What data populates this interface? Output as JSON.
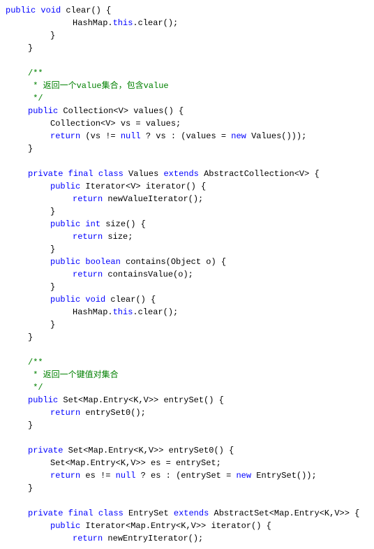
{
  "lines": [
    {
      "indent": 0,
      "tokens": [
        {
          "t": "kw",
          "s": "public"
        },
        {
          "t": "sp"
        },
        {
          "t": "kw",
          "s": "void"
        },
        {
          "t": "pl",
          "s": " clear() {"
        }
      ]
    },
    {
      "indent": 3,
      "tokens": [
        {
          "t": "pl",
          "s": "HashMap."
        },
        {
          "t": "kw",
          "s": "this"
        },
        {
          "t": "pl",
          "s": ".clear();"
        }
      ]
    },
    {
      "indent": 2,
      "tokens": [
        {
          "t": "pl",
          "s": "}"
        }
      ]
    },
    {
      "indent": 1,
      "tokens": [
        {
          "t": "pl",
          "s": "}"
        }
      ]
    },
    {
      "indent": 0,
      "tokens": []
    },
    {
      "indent": 1,
      "tokens": [
        {
          "t": "cm",
          "s": "/**"
        }
      ]
    },
    {
      "indent": 1,
      "tokens": [
        {
          "t": "cm",
          "s": " * 返回一个value集合，包含value"
        }
      ]
    },
    {
      "indent": 1,
      "tokens": [
        {
          "t": "cm",
          "s": " */"
        }
      ]
    },
    {
      "indent": 1,
      "tokens": [
        {
          "t": "kw",
          "s": "public"
        },
        {
          "t": "pl",
          "s": " Collection<V> values() {"
        }
      ]
    },
    {
      "indent": 2,
      "tokens": [
        {
          "t": "pl",
          "s": "Collection<V> vs = values;"
        }
      ]
    },
    {
      "indent": 2,
      "tokens": [
        {
          "t": "kw",
          "s": "return"
        },
        {
          "t": "pl",
          "s": " (vs != "
        },
        {
          "t": "kw",
          "s": "null"
        },
        {
          "t": "pl",
          "s": " ? vs : (values = "
        },
        {
          "t": "kw",
          "s": "new"
        },
        {
          "t": "pl",
          "s": " Values()));"
        }
      ]
    },
    {
      "indent": 1,
      "tokens": [
        {
          "t": "pl",
          "s": "}"
        }
      ]
    },
    {
      "indent": 0,
      "tokens": []
    },
    {
      "indent": 1,
      "tokens": [
        {
          "t": "kw",
          "s": "private"
        },
        {
          "t": "sp"
        },
        {
          "t": "kw",
          "s": "final"
        },
        {
          "t": "sp"
        },
        {
          "t": "kw",
          "s": "class"
        },
        {
          "t": "pl",
          "s": " Values "
        },
        {
          "t": "kw",
          "s": "extends"
        },
        {
          "t": "pl",
          "s": " AbstractCollection<V> {"
        }
      ]
    },
    {
      "indent": 2,
      "tokens": [
        {
          "t": "kw",
          "s": "public"
        },
        {
          "t": "pl",
          "s": " Iterator<V> iterator() {"
        }
      ]
    },
    {
      "indent": 3,
      "tokens": [
        {
          "t": "kw",
          "s": "return"
        },
        {
          "t": "pl",
          "s": " newValueIterator();"
        }
      ]
    },
    {
      "indent": 2,
      "tokens": [
        {
          "t": "pl",
          "s": "}"
        }
      ]
    },
    {
      "indent": 2,
      "tokens": [
        {
          "t": "kw",
          "s": "public"
        },
        {
          "t": "sp"
        },
        {
          "t": "kw",
          "s": "int"
        },
        {
          "t": "pl",
          "s": " size() {"
        }
      ]
    },
    {
      "indent": 3,
      "tokens": [
        {
          "t": "kw",
          "s": "return"
        },
        {
          "t": "pl",
          "s": " size;"
        }
      ]
    },
    {
      "indent": 2,
      "tokens": [
        {
          "t": "pl",
          "s": "}"
        }
      ]
    },
    {
      "indent": 2,
      "tokens": [
        {
          "t": "kw",
          "s": "public"
        },
        {
          "t": "sp"
        },
        {
          "t": "kw",
          "s": "boolean"
        },
        {
          "t": "pl",
          "s": " contains(Object o) {"
        }
      ]
    },
    {
      "indent": 3,
      "tokens": [
        {
          "t": "kw",
          "s": "return"
        },
        {
          "t": "pl",
          "s": " containsValue(o);"
        }
      ]
    },
    {
      "indent": 2,
      "tokens": [
        {
          "t": "pl",
          "s": "}"
        }
      ]
    },
    {
      "indent": 2,
      "tokens": [
        {
          "t": "kw",
          "s": "public"
        },
        {
          "t": "sp"
        },
        {
          "t": "kw",
          "s": "void"
        },
        {
          "t": "pl",
          "s": " clear() {"
        }
      ]
    },
    {
      "indent": 3,
      "tokens": [
        {
          "t": "pl",
          "s": "HashMap."
        },
        {
          "t": "kw",
          "s": "this"
        },
        {
          "t": "pl",
          "s": ".clear();"
        }
      ]
    },
    {
      "indent": 2,
      "tokens": [
        {
          "t": "pl",
          "s": "}"
        }
      ]
    },
    {
      "indent": 1,
      "tokens": [
        {
          "t": "pl",
          "s": "}"
        }
      ]
    },
    {
      "indent": 0,
      "tokens": []
    },
    {
      "indent": 1,
      "tokens": [
        {
          "t": "cm",
          "s": "/**"
        }
      ]
    },
    {
      "indent": 1,
      "tokens": [
        {
          "t": "cm",
          "s": " * 返回一个键值对集合"
        }
      ]
    },
    {
      "indent": 1,
      "tokens": [
        {
          "t": "cm",
          "s": " */"
        }
      ]
    },
    {
      "indent": 1,
      "tokens": [
        {
          "t": "kw",
          "s": "public"
        },
        {
          "t": "pl",
          "s": " Set<Map.Entry<K,V>> entrySet() {"
        }
      ]
    },
    {
      "indent": 2,
      "tokens": [
        {
          "t": "kw",
          "s": "return"
        },
        {
          "t": "pl",
          "s": " entrySet0();"
        }
      ]
    },
    {
      "indent": 1,
      "tokens": [
        {
          "t": "pl",
          "s": "}"
        }
      ]
    },
    {
      "indent": 0,
      "tokens": []
    },
    {
      "indent": 1,
      "tokens": [
        {
          "t": "kw",
          "s": "private"
        },
        {
          "t": "pl",
          "s": " Set<Map.Entry<K,V>> entrySet0() {"
        }
      ]
    },
    {
      "indent": 2,
      "tokens": [
        {
          "t": "pl",
          "s": "Set<Map.Entry<K,V>> es = entrySet;"
        }
      ]
    },
    {
      "indent": 2,
      "tokens": [
        {
          "t": "kw",
          "s": "return"
        },
        {
          "t": "pl",
          "s": " es != "
        },
        {
          "t": "kw",
          "s": "null"
        },
        {
          "t": "pl",
          "s": " ? es : (entrySet = "
        },
        {
          "t": "kw",
          "s": "new"
        },
        {
          "t": "pl",
          "s": " EntrySet());"
        }
      ]
    },
    {
      "indent": 1,
      "tokens": [
        {
          "t": "pl",
          "s": "}"
        }
      ]
    },
    {
      "indent": 0,
      "tokens": []
    },
    {
      "indent": 1,
      "tokens": [
        {
          "t": "kw",
          "s": "private"
        },
        {
          "t": "sp"
        },
        {
          "t": "kw",
          "s": "final"
        },
        {
          "t": "sp"
        },
        {
          "t": "kw",
          "s": "class"
        },
        {
          "t": "pl",
          "s": " EntrySet "
        },
        {
          "t": "kw",
          "s": "extends"
        },
        {
          "t": "pl",
          "s": " AbstractSet<Map.Entry<K,V>> {"
        }
      ]
    },
    {
      "indent": 2,
      "tokens": [
        {
          "t": "kw",
          "s": "public"
        },
        {
          "t": "pl",
          "s": " Iterator<Map.Entry<K,V>> iterator() {"
        }
      ]
    },
    {
      "indent": 3,
      "tokens": [
        {
          "t": "kw",
          "s": "return"
        },
        {
          "t": "pl",
          "s": " newEntryIterator();"
        }
      ]
    }
  ]
}
